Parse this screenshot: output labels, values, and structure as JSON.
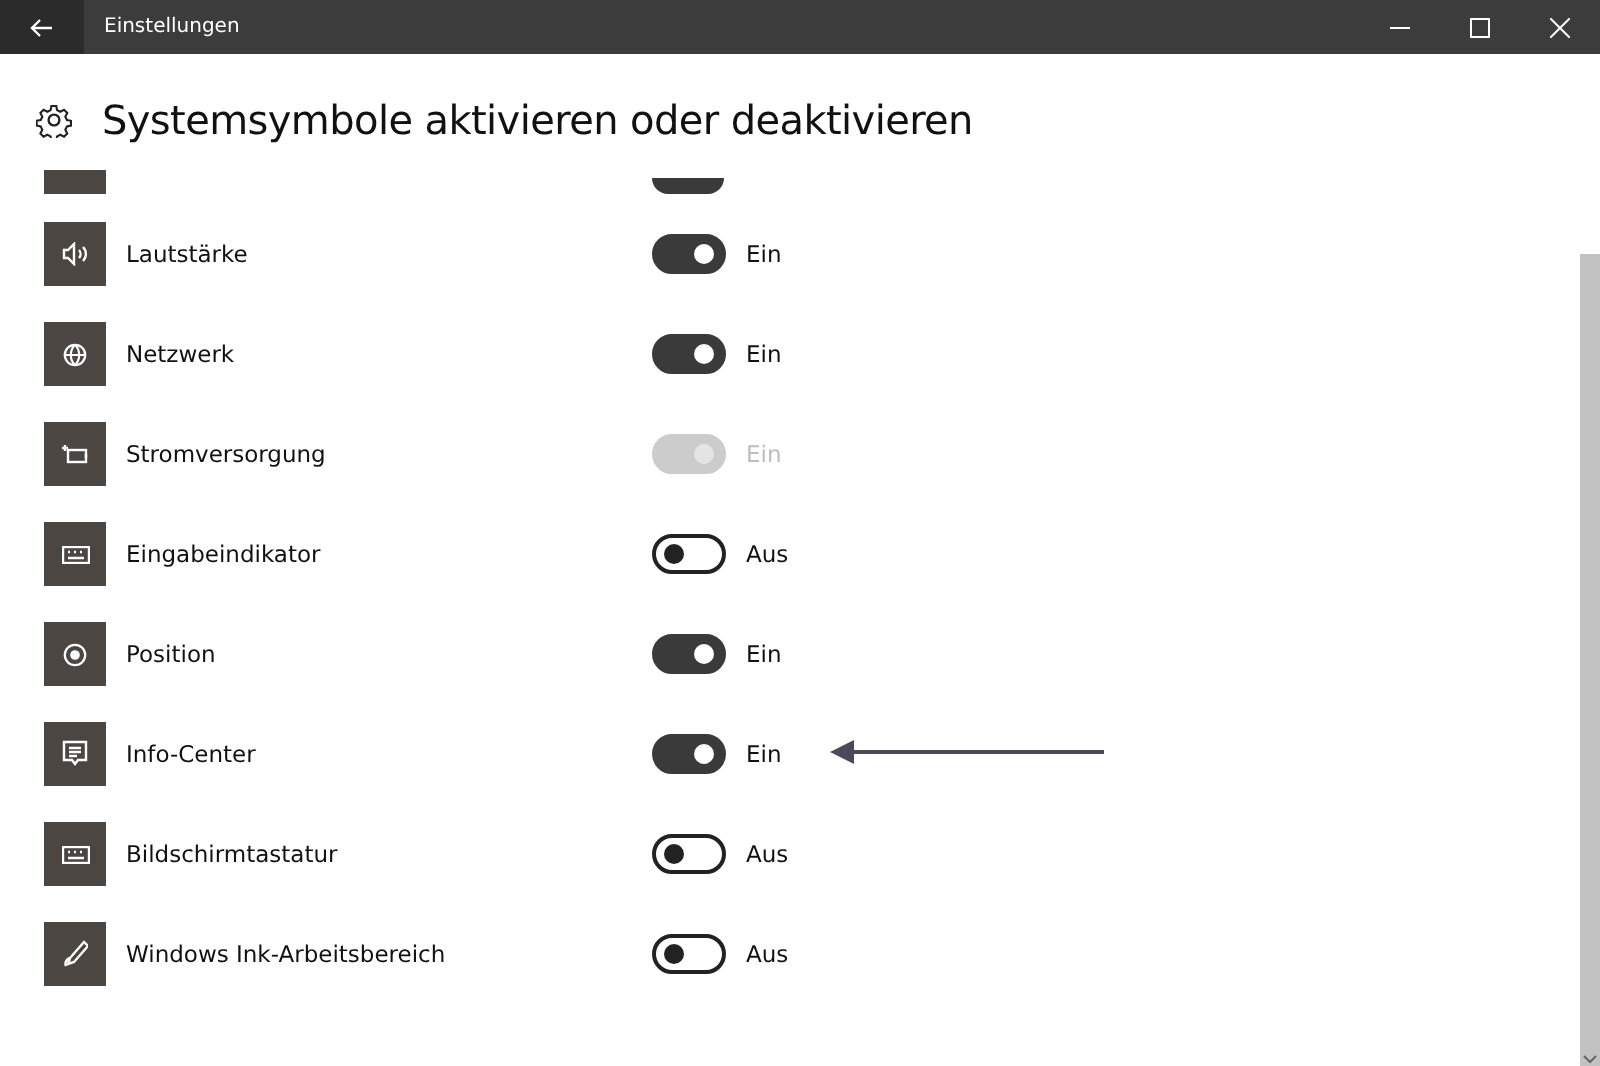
{
  "window": {
    "title": "Einstellungen"
  },
  "page": {
    "title": "Systemsymbole aktivieren oder deaktivieren"
  },
  "partial_row": {
    "on": true
  },
  "rows": [
    {
      "label": "Lautstärke",
      "on": true,
      "disabled": false,
      "state": "Ein"
    },
    {
      "label": "Netzwerk",
      "on": true,
      "disabled": false,
      "state": "Ein"
    },
    {
      "label": "Stromversorgung",
      "on": true,
      "disabled": true,
      "state": "Ein"
    },
    {
      "label": "Eingabeindikator",
      "on": false,
      "disabled": false,
      "state": "Aus"
    },
    {
      "label": "Position",
      "on": true,
      "disabled": false,
      "state": "Ein"
    },
    {
      "label": "Info-Center",
      "on": true,
      "disabled": false,
      "state": "Ein"
    },
    {
      "label": "Bildschirmtastatur",
      "on": false,
      "disabled": false,
      "state": "Aus"
    },
    {
      "label": "Windows Ink-Arbeitsbereich",
      "on": false,
      "disabled": false,
      "state": "Aus"
    }
  ]
}
